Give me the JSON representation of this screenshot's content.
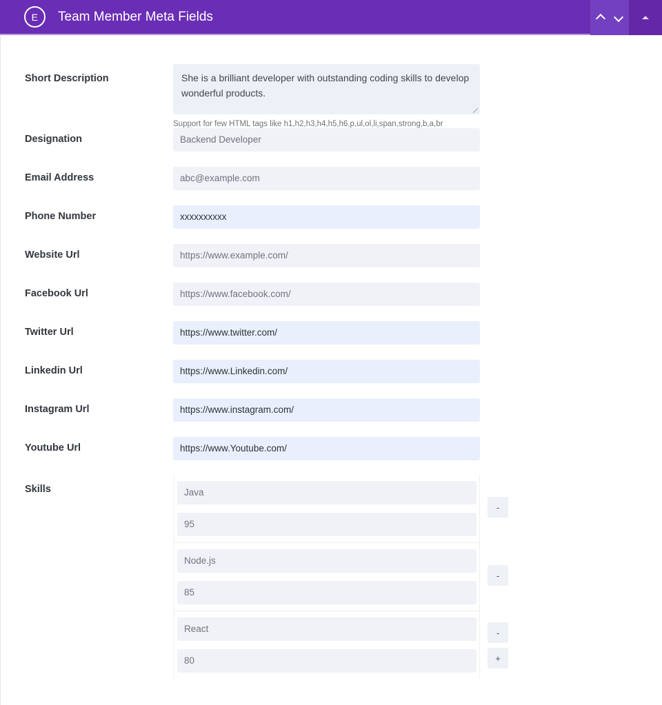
{
  "header": {
    "logo_letter": "E",
    "title": "Team Member Meta Fields",
    "icons": {
      "up": "chevron-up-icon",
      "down": "chevron-down-icon",
      "collapse": "triangle-up-icon"
    }
  },
  "form": {
    "short_description": {
      "label": "Short Description",
      "value": "She is a brilliant developer with outstanding coding skills to develop wonderful products.",
      "hint": "Support for few HTML tags like h1,h2,h3,h4,h5,h6,p,ul,ol,li,span,strong,b,a,br"
    },
    "fields": [
      {
        "label": "Designation",
        "value": "Backend Developer",
        "style": "muted"
      },
      {
        "label": "Email Address",
        "value": "abc@example.com",
        "style": "muted"
      },
      {
        "label": "Phone Number",
        "value": "xxxxxxxxxx",
        "style": "filled"
      },
      {
        "label": "Website Url",
        "value": "https://www.example.com/",
        "style": "muted"
      },
      {
        "label": "Facebook Url",
        "value": "https://www.facebook.com/",
        "style": "muted"
      },
      {
        "label": "Twitter Url",
        "value": "https://www.twitter.com/",
        "style": "filled"
      },
      {
        "label": "Linkedin Url",
        "value": "https://www.Linkedin.com/",
        "style": "filled"
      },
      {
        "label": "Instagram Url",
        "value": "https://www.instagram.com/",
        "style": "filled"
      },
      {
        "label": "Youtube Url",
        "value": "https://www.Youtube.com/",
        "style": "filled"
      }
    ],
    "skills": {
      "label": "Skills",
      "remove_label": "-",
      "add_label": "+",
      "items": [
        {
          "name": "Java",
          "value": "95"
        },
        {
          "name": "Node.js",
          "value": "85"
        },
        {
          "name": "React",
          "value": "80"
        }
      ]
    }
  },
  "colors": {
    "header_purple": "#6a2db5",
    "header_nav_purple": "#7440c2",
    "header_collapse_purple": "#6327a8",
    "input_muted": "#f0f2f7",
    "input_filled": "#e9effc"
  }
}
